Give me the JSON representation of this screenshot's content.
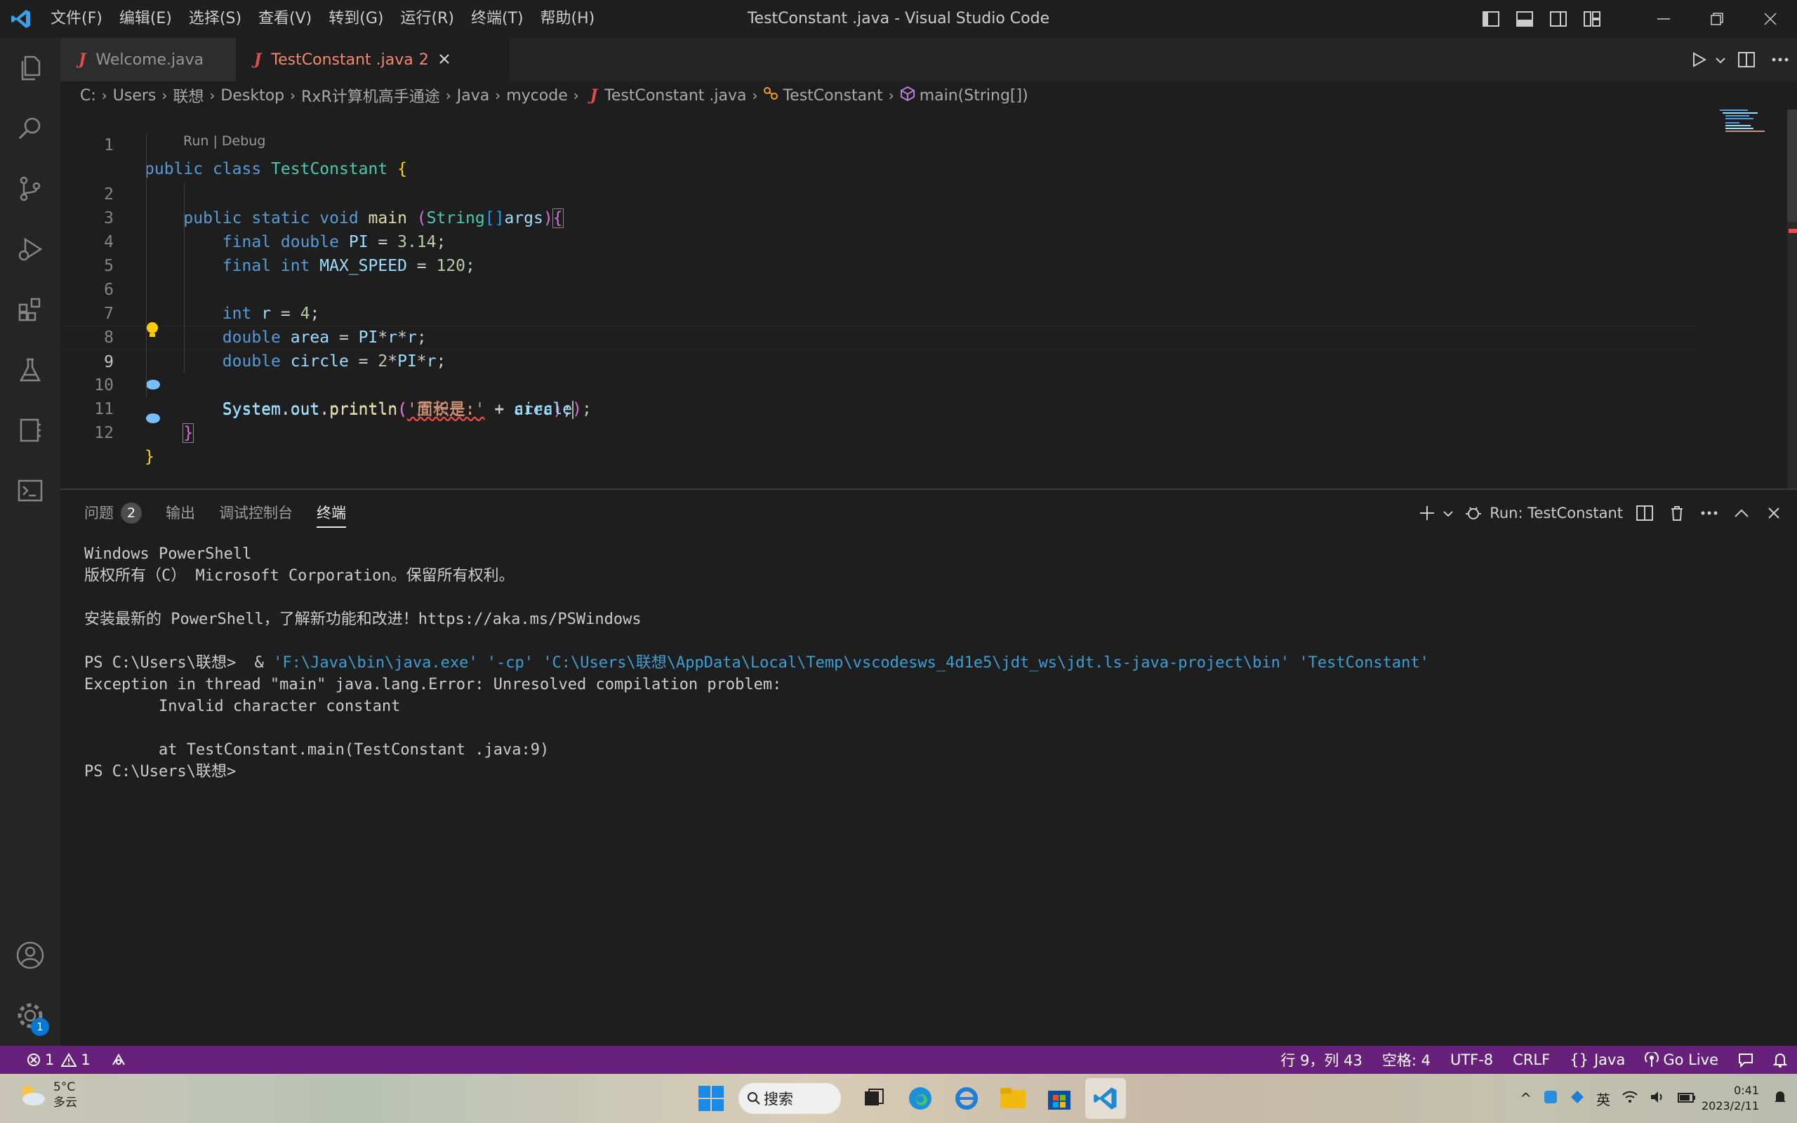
{
  "window": {
    "title": "TestConstant .java - Visual Studio Code",
    "menu": [
      "文件(F)",
      "编辑(E)",
      "选择(S)",
      "查看(V)",
      "转到(G)",
      "运行(R)",
      "终端(T)",
      "帮助(H)"
    ]
  },
  "tabs": [
    {
      "label": "Welcome.java",
      "active": false
    },
    {
      "label": "TestConstant .java",
      "problems": "2",
      "active": true
    }
  ],
  "breadcrumb": [
    "C:",
    "Users",
    "联想",
    "Desktop",
    "RxR计算机高手通途",
    "Java",
    "mycode",
    "TestConstant .java",
    "TestConstant",
    "main(String[])"
  ],
  "editor": {
    "codelens": "Run | Debug",
    "line_numbers": [
      "1",
      "2",
      "3",
      "4",
      "5",
      "6",
      "7",
      "8",
      "9",
      "10",
      "11",
      "12"
    ],
    "cursor": "行 9，列 43"
  },
  "panel": {
    "tabs": [
      "问题",
      "输出",
      "调试控制台",
      "终端"
    ],
    "problems_count": "2",
    "active_tab": "终端",
    "run_label": "Run: TestConstant",
    "terminal_lines": [
      "Windows PowerShell",
      "版权所有（C） Microsoft Corporation。保留所有权利。",
      "",
      "安装最新的 PowerShell，了解新功能和改进！https://aka.ms/PSWindows",
      "",
      "PS C:\\Users\\联想>  & 'F:\\Java\\bin\\java.exe' '-cp' 'C:\\Users\\联想\\AppData\\Local\\Temp\\vscodesws_4d1e5\\jdt_ws\\jdt.ls-java-project\\bin' 'TestConstant'",
      "Exception in thread \"main\" java.lang.Error: Unresolved compilation problem:",
      "        Invalid character constant",
      "",
      "        at TestConstant.main(TestConstant .java:9)",
      "PS C:\\Users\\联想>"
    ],
    "prompt_prefix": "PS C:\\Users\\联想>  & ",
    "command": "'F:\\Java\\bin\\java.exe' '-cp' 'C:\\Users\\联想\\AppData\\Local\\Temp\\vscodesws_4d1e5\\jdt_ws\\jdt.ls-java-project\\bin' 'TestConstant'"
  },
  "statusbar": {
    "errors": "1",
    "warnings": "1",
    "position": "行 9，列 43",
    "spaces": "空格: 4",
    "encoding": "UTF-8",
    "eol": "CRLF",
    "language": "Java",
    "golive": "Go Live",
    "color": "#68217a"
  },
  "taskbar": {
    "weather_temp": "5°C",
    "weather_desc": "多云",
    "search": "搜索",
    "ime": "英",
    "time": "0:41",
    "date": "2023/2/11"
  },
  "settings_badge": "1"
}
